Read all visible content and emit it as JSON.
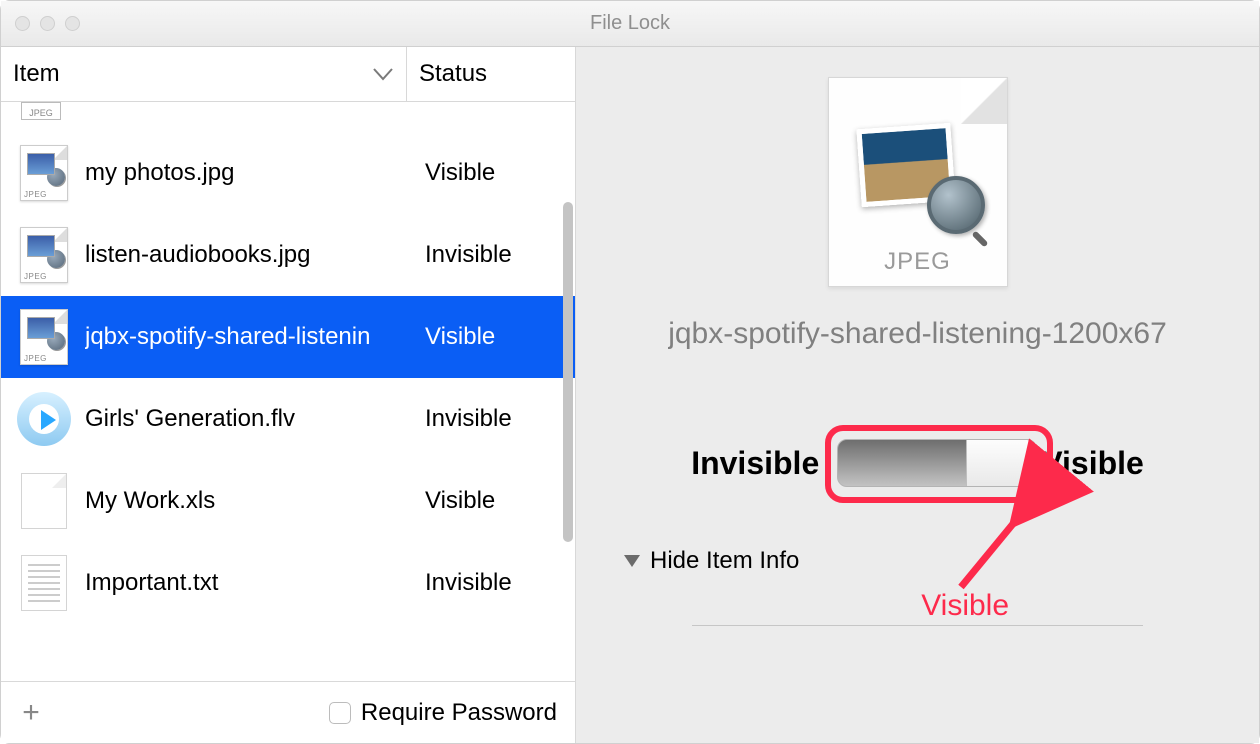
{
  "window": {
    "title": "File Lock"
  },
  "columns": {
    "item": "Item",
    "status": "Status"
  },
  "rows": [
    {
      "name": "my photos.jpg",
      "status": "Visible",
      "type": "jpeg"
    },
    {
      "name": "listen-audiobooks.jpg",
      "status": "Invisible",
      "type": "jpeg"
    },
    {
      "name": "jqbx-spotify-shared-listenin",
      "status": "Visible",
      "type": "jpeg",
      "selected": true
    },
    {
      "name": "Girls' Generation.flv",
      "status": "Invisible",
      "type": "flv"
    },
    {
      "name": "My Work.xls",
      "status": "Visible",
      "type": "blank"
    },
    {
      "name": "Important.txt",
      "status": "Invisible",
      "type": "txt"
    }
  ],
  "footer": {
    "require_password_label": "Require Password"
  },
  "detail": {
    "filetype_label": "JPEG",
    "filename": "jqbx-spotify-shared-listening-1200x67",
    "toggle_left": "Invisible",
    "toggle_right": "Visible",
    "annotation": "Visible",
    "hide_info": "Hide Item Info"
  }
}
